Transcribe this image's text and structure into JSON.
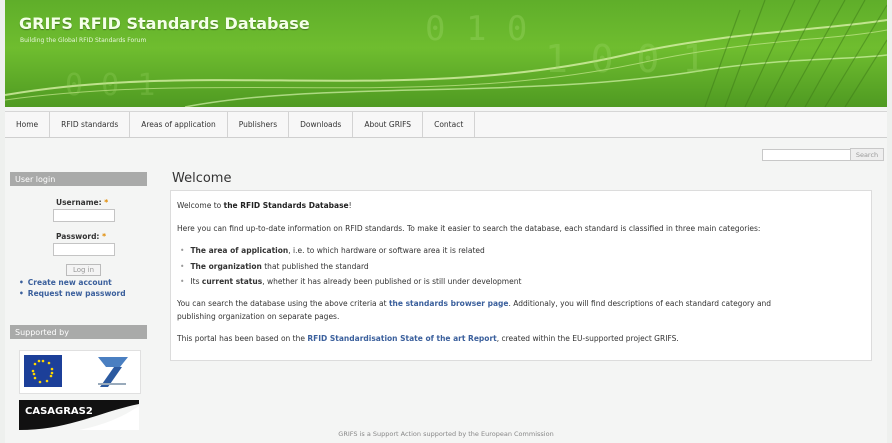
{
  "header": {
    "title": "GRIFS RFID Standards Database",
    "slogan": "Building the Global RFID Standards Forum"
  },
  "nav": [
    "Home",
    "RFID standards",
    "Areas of application",
    "Publishers",
    "Downloads",
    "About GRIFS",
    "Contact"
  ],
  "search": {
    "button_label": "Search"
  },
  "login": {
    "title": "User login",
    "username_label": "Username:",
    "password_label": "Password:",
    "required_mark": "*",
    "button_label": "Log in",
    "links": [
      "Create new account",
      "Request new password"
    ]
  },
  "supported": {
    "title": "Supported by",
    "casagras_label": "CASAGRAS2"
  },
  "main": {
    "title": "Welcome",
    "intro_prefix": "Welcome to ",
    "intro_bold": "the RFID Standards Database",
    "intro_suffix": "!",
    "p2": "Here you can find up-to-date information on RFID standards. To make it easier to search the database, each standard is classified in three main categories:",
    "bullets": [
      {
        "pre": "",
        "bold": "The area of application",
        "post": ", i.e. to which hardware or software area it is related"
      },
      {
        "pre": "",
        "bold": "The organization",
        "post": " that published the standard"
      },
      {
        "pre": "Its ",
        "bold": "current status",
        "post": ", whether it has already been published or is still under development"
      }
    ],
    "p3_pre": "You can search the database using the above criteria at ",
    "p3_link": "the standards browser page",
    "p3_post": ". Additionaly, you will find descriptions of each standard category and",
    "p3_line2": "publishing organization on separate pages.",
    "p4_pre": "This portal has been based on the ",
    "p4_link": "RFID Standardisation State of the art Report",
    "p4_post": ", created within the EU-supported project GRIFS."
  },
  "footer": "GRIFS is a Support Action supported by the European Commission",
  "colors": {
    "header_green": "#6fbd2f",
    "link_blue": "#3a5f9c",
    "required_orange": "#e08a00",
    "sidebar_gray": "#a9aaa9"
  }
}
